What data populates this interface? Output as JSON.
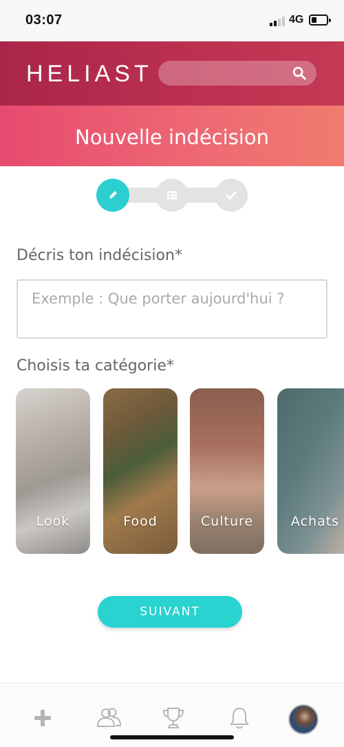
{
  "status_bar": {
    "time": "03:07",
    "network": "4G"
  },
  "header": {
    "logo": "HELIAST",
    "search_icon": "search-icon"
  },
  "title": "Nouvelle indécision",
  "stepper": {
    "steps": [
      {
        "icon": "pencil-icon",
        "active": true
      },
      {
        "icon": "list-icon",
        "active": false
      },
      {
        "icon": "check-icon",
        "active": false
      }
    ]
  },
  "form": {
    "description_label": "Décris ton indécision*",
    "description_placeholder": "Exemple : Que porter aujourd'hui ?",
    "category_label": "Choisis ta catégorie*",
    "categories": [
      {
        "label": "Look"
      },
      {
        "label": "Food"
      },
      {
        "label": "Culture"
      },
      {
        "label": "Achats"
      }
    ]
  },
  "actions": {
    "next_label": "SUIVANT"
  },
  "tab_bar": {
    "items": [
      "plus-icon",
      "users-icon",
      "trophy-icon",
      "bell-icon",
      "avatar"
    ]
  },
  "colors": {
    "accent": "#2bcfcf",
    "header_dark": "#b12d4e",
    "header_gradient_start": "#e64a6f",
    "header_gradient_end": "#f07b6e"
  }
}
